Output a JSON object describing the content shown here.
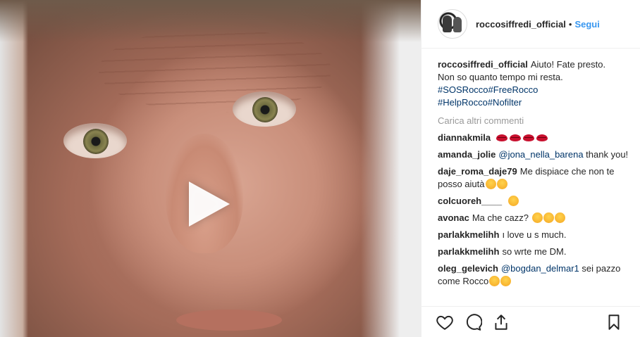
{
  "post": {
    "author": "roccosiffredi_official",
    "follow_label": "Segui",
    "dot": "•"
  },
  "caption": {
    "user": "roccosiffredi_official",
    "text_line1": "Aiuto! Fate presto.",
    "text_line2": "Non so quanto tempo mi resta.",
    "tags_line1": [
      "#SOSRocco",
      "#FreeRocco"
    ],
    "tags_line2": [
      "#HelpRocco",
      "#Nofilter"
    ]
  },
  "load_more": "Carica altri commenti",
  "comments": [
    {
      "user": "diannakmila",
      "text": "",
      "emojis": [
        "kiss-mark",
        "kiss-mark",
        "kiss-mark",
        "kiss-mark"
      ]
    },
    {
      "user": "amanda_jolie",
      "mention": "@jona_nella_barena",
      "text": " thank you!"
    },
    {
      "user": "daje_roma_daje79",
      "text": "Me dispiace che non te posso aiutà",
      "emojis": [
        "sweat-smile",
        "kissing-heart"
      ]
    },
    {
      "user": "colcuoreh____",
      "text": "",
      "emojis": [
        "grimacing"
      ]
    },
    {
      "user": "avonac",
      "text": "Ma che cazz?",
      "emojis": [
        "astonished",
        "flushed",
        "thinking"
      ]
    },
    {
      "user": "parlakkmelihh",
      "text": "ı love u s much."
    },
    {
      "user": "parlakkmelihh",
      "text": "so wrte me DM."
    },
    {
      "user": "oleg_gelevich",
      "mention": "@bogdan_delmar1",
      "text": " sei pazzo come Rocco",
      "emojis": [
        "joy",
        "joy"
      ]
    }
  ],
  "icons": {
    "like": "heart-icon",
    "comment": "comment-icon",
    "share": "share-icon",
    "save": "bookmark-icon",
    "play": "play-icon"
  },
  "colors": {
    "link": "#3897f0",
    "tag": "#003569",
    "muted": "#999999"
  }
}
